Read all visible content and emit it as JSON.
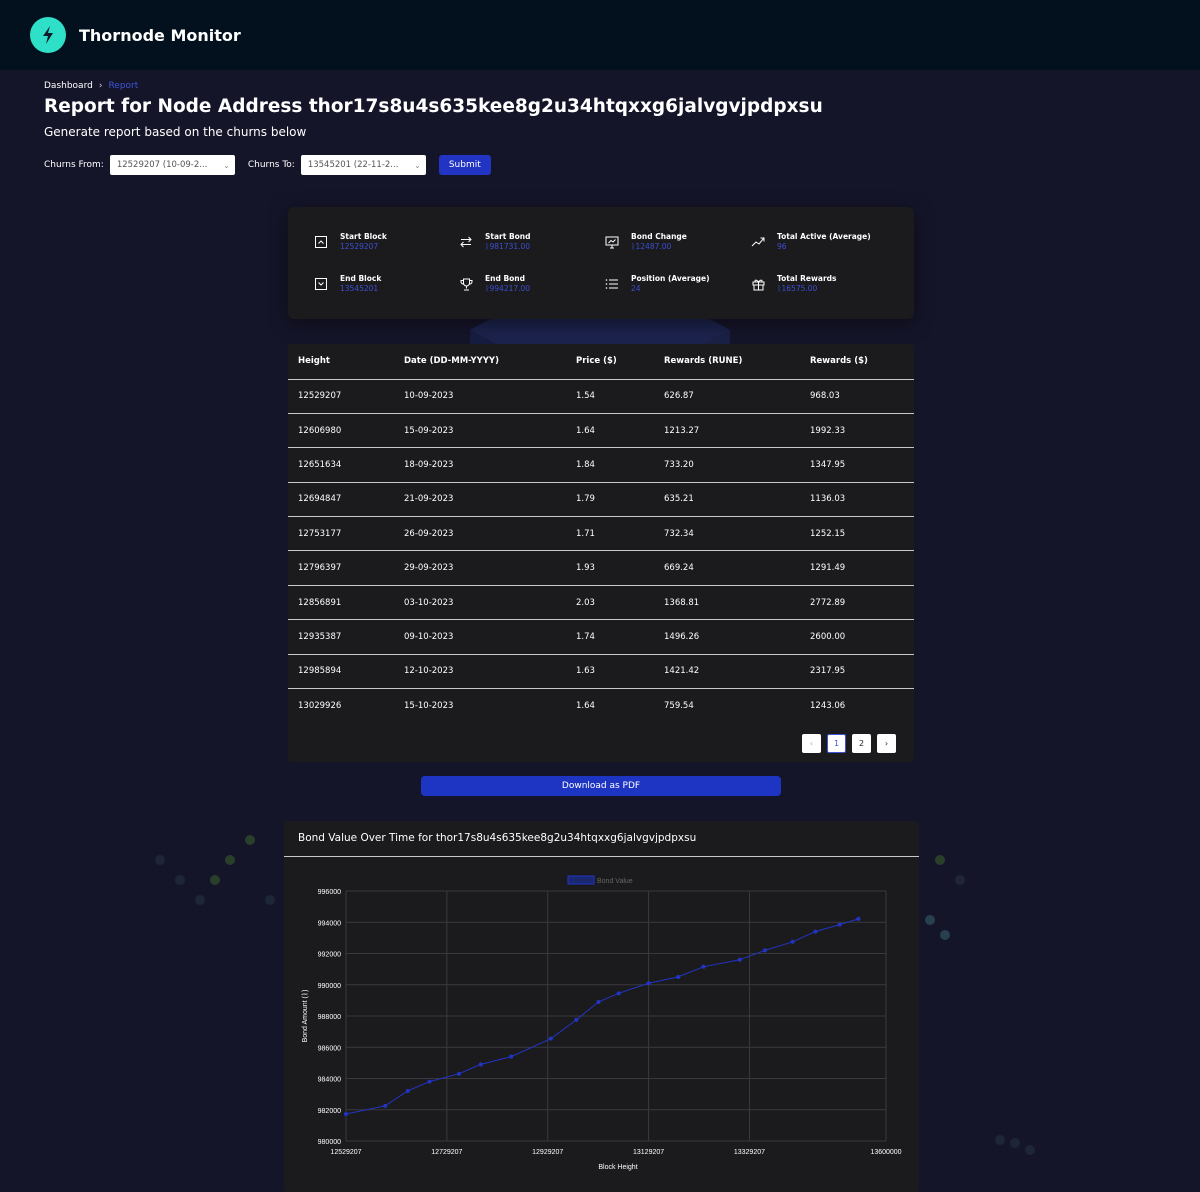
{
  "app": {
    "title": "Thornode Monitor"
  },
  "breadcrumb": {
    "home": "Dashboard",
    "current": "Report"
  },
  "page": {
    "title": "Report for Node Address thor17s8u4s635kee8g2u34htqxxg6jalvgvjpdpxsu",
    "subtitle": "Generate report based on the churns below"
  },
  "filters": {
    "from_label": "Churns From:",
    "from_value": "12529207 (10-09-2...",
    "to_label": "Churns To:",
    "to_value": "13545201 (22-11-2...",
    "submit_label": "Submit"
  },
  "stats": [
    {
      "label": "Start Block",
      "value": "12529207",
      "icon": "caret-up-box-icon"
    },
    {
      "label": "Start Bond",
      "value": "ᚱ981731.00",
      "icon": "transfer-arrows-icon"
    },
    {
      "label": "Bond Change",
      "value": "ᚱ12487.00",
      "icon": "presentation-chart-icon"
    },
    {
      "label": "Total Active (Average)",
      "value": "96",
      "icon": "trending-up-icon"
    },
    {
      "label": "End Block",
      "value": "13545201",
      "icon": "caret-down-box-icon"
    },
    {
      "label": "End Bond",
      "value": "ᚱ994217.00",
      "icon": "trophy-icon"
    },
    {
      "label": "Position (Average)",
      "value": "24",
      "icon": "list-icon"
    },
    {
      "label": "Total Rewards",
      "value": "ᚱ16575.00",
      "icon": "gift-icon"
    }
  ],
  "table": {
    "headers": [
      "Height",
      "Date (DD-MM-YYYY)",
      "Price ($)",
      "Rewards (RUNE)",
      "Rewards ($)"
    ],
    "rows": [
      [
        "12529207",
        "10-09-2023",
        "1.54",
        "626.87",
        "968.03"
      ],
      [
        "12606980",
        "15-09-2023",
        "1.64",
        "1213.27",
        "1992.33"
      ],
      [
        "12651634",
        "18-09-2023",
        "1.84",
        "733.20",
        "1347.95"
      ],
      [
        "12694847",
        "21-09-2023",
        "1.79",
        "635.21",
        "1136.03"
      ],
      [
        "12753177",
        "26-09-2023",
        "1.71",
        "732.34",
        "1252.15"
      ],
      [
        "12796397",
        "29-09-2023",
        "1.93",
        "669.24",
        "1291.49"
      ],
      [
        "12856891",
        "03-10-2023",
        "2.03",
        "1368.81",
        "2772.89"
      ],
      [
        "12935387",
        "09-10-2023",
        "1.74",
        "1496.26",
        "2600.00"
      ],
      [
        "12985894",
        "12-10-2023",
        "1.63",
        "1421.42",
        "2317.95"
      ],
      [
        "13029926",
        "15-10-2023",
        "1.64",
        "759.54",
        "1243.06"
      ]
    ]
  },
  "pagination": {
    "prev": "‹",
    "pages": [
      "1",
      "2"
    ],
    "next": "›",
    "active": "1"
  },
  "download_label": "Download as PDF",
  "colors": {
    "accent": "#2234c4",
    "value_text": "#3b4fd0",
    "logo": "#2fe0c8"
  },
  "chart_data": {
    "type": "line",
    "title": "Bond Value Over Time for thor17s8u4s635kee8g2u34htqxxg6jalvgvjpdpxsu",
    "legend": "Bond Value",
    "legend_position": "top",
    "xlabel": "Block Height",
    "ylabel": "Bond Amount (ᚱ)",
    "xlim": [
      12529207,
      13600000
    ],
    "ylim": [
      980000,
      996000
    ],
    "xticks": [
      "12529207",
      "12729207",
      "12929207",
      "13129207",
      "13329207",
      "13600000"
    ],
    "yticks": [
      "980000",
      "982000",
      "984000",
      "986000",
      "988000",
      "990000",
      "992000",
      "994000",
      "996000"
    ],
    "grid": true,
    "series": [
      {
        "name": "Bond Value",
        "color": "#2234c4",
        "points": [
          [
            12529207,
            981731
          ],
          [
            12606980,
            982250
          ],
          [
            12651634,
            983200
          ],
          [
            12694847,
            983800
          ],
          [
            12753177,
            984300
          ],
          [
            12796397,
            984900
          ],
          [
            12856891,
            985400
          ],
          [
            12935387,
            986550
          ],
          [
            12985894,
            987750
          ],
          [
            13029926,
            988900
          ],
          [
            13070000,
            989450
          ],
          [
            13129207,
            990100
          ],
          [
            13188000,
            990500
          ],
          [
            13238000,
            991150
          ],
          [
            13310000,
            991600
          ],
          [
            13360000,
            992200
          ],
          [
            13415000,
            992750
          ],
          [
            13460000,
            993400
          ],
          [
            13508000,
            993850
          ],
          [
            13545201,
            994217
          ]
        ]
      }
    ]
  }
}
